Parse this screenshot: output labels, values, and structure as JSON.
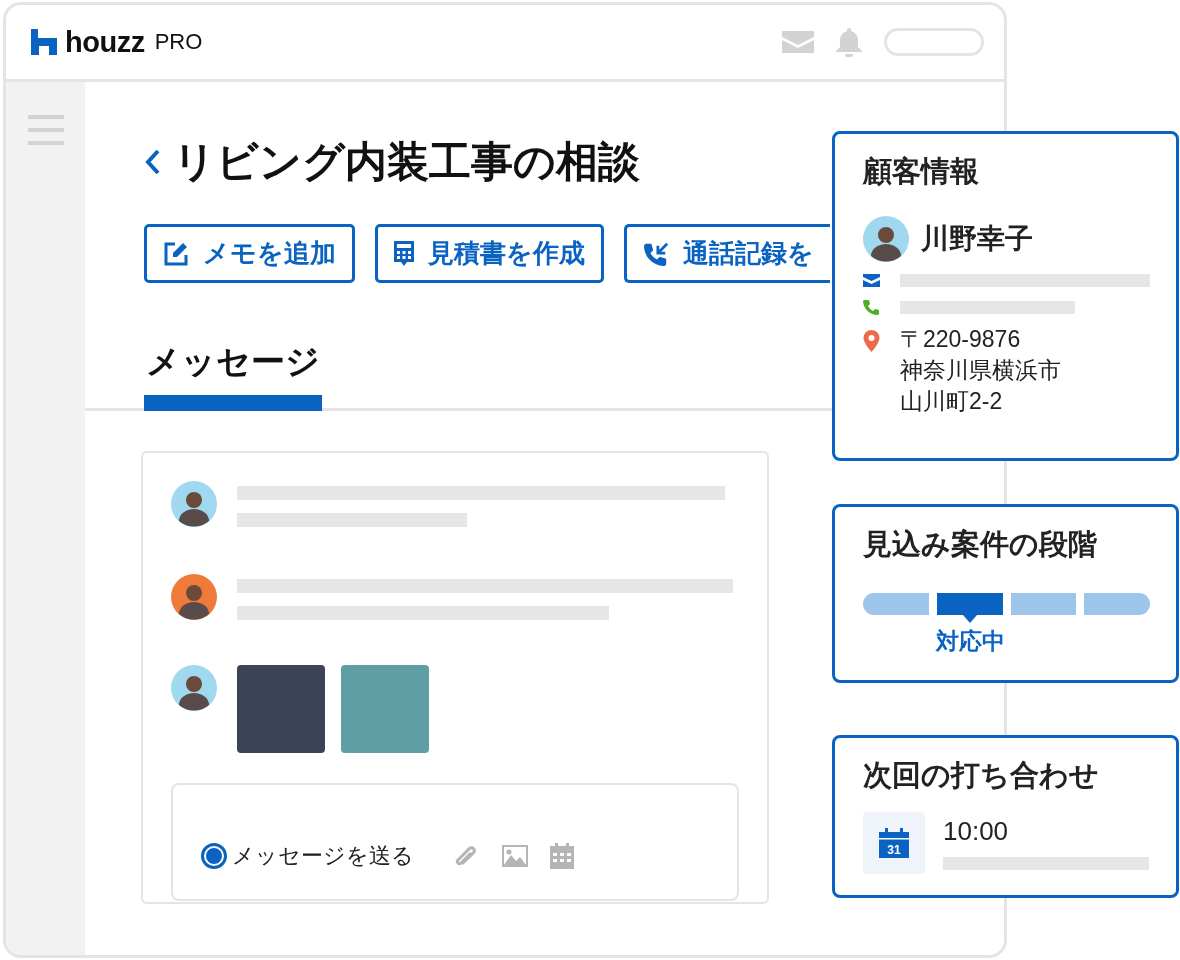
{
  "header": {
    "logo_word": "houzz",
    "logo_suffix": "PRO"
  },
  "title": "リビング内装工事の相談",
  "actions": [
    {
      "kind": "memo",
      "label": "メモを追加"
    },
    {
      "kind": "estimate",
      "label": "見積書を作成"
    },
    {
      "kind": "call",
      "label": "通話記録を"
    }
  ],
  "tabs": [
    {
      "label": "メッセージ",
      "selected": true
    }
  ],
  "messages": [
    {
      "kind": "text",
      "color": "#9fd8ef"
    },
    {
      "kind": "text",
      "color": "#ee7b3a"
    },
    {
      "kind": "photos",
      "color": "#9fd8ef"
    }
  ],
  "composer": {
    "label": "メッセージを送る",
    "selected": true
  },
  "customer": {
    "title": "顧客情報",
    "name": "川野幸子",
    "address": [
      "〒220-9876",
      "神奈川県横浜市",
      "山川町2-2"
    ]
  },
  "stage": {
    "title": "見込み案件の段階",
    "segments": [
      {
        "selected": false
      },
      {
        "selected": true,
        "label": "対応中"
      },
      {
        "selected": false
      },
      {
        "selected": false
      }
    ]
  },
  "meeting": {
    "title": "次回の打ち合わせ",
    "day": "31",
    "time": "10:00"
  }
}
